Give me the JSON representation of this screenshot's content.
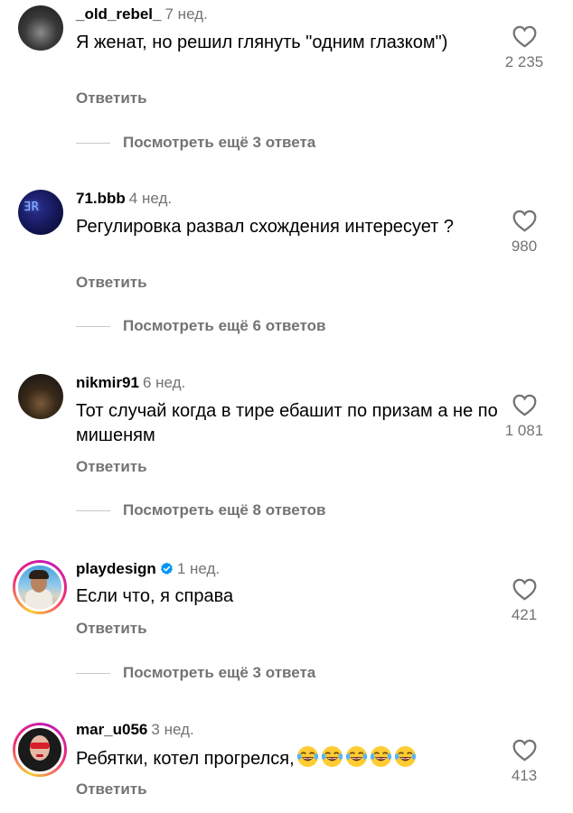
{
  "comments": [
    {
      "username": "_old_rebel_",
      "time": "7 нед.",
      "text": "Я женат, но решил глянуть \"одним глазком\")",
      "likes": "2 235",
      "reply_label": "Ответить",
      "more_replies": "Посмотреть ещё 3 ответа",
      "avatar_icon": "avatar-photo-dark"
    },
    {
      "username": "71.bbb",
      "time": "4 нед.",
      "text": "Регулировка развал схождения интересует ?",
      "likes": "980",
      "reply_label": "Ответить",
      "more_replies": "Посмотреть ещё 6 ответов",
      "avatar_icon": "avatar-neon-sign"
    },
    {
      "username": "nikmir91",
      "time": "6 нед.",
      "text": "Тот случай когда в тире ебашит по призам а не по мишеням",
      "likes": "1 081",
      "reply_label": "Ответить",
      "more_replies": "Посмотреть ещё 8 ответов",
      "avatar_icon": "avatar-photo-night"
    },
    {
      "username": "playdesign",
      "verified": true,
      "time": "1 нед.",
      "text": "Если что, я справа",
      "likes": "421",
      "reply_label": "Ответить",
      "more_replies": "Посмотреть ещё 3 ответа",
      "avatar_icon": "avatar-story-ring"
    },
    {
      "username": "mar_u056",
      "time": "3 нед.",
      "text": "Ребятки, котел прогрелся,",
      "emoji": "😂😂😂😂😂",
      "likes": "413",
      "reply_label": "Ответить",
      "avatar_icon": "avatar-story-ring"
    }
  ],
  "colors": {
    "secondary_text": "#737373",
    "verified_blue": "#0095f6",
    "divider": "#c7c7c7"
  },
  "icons": {
    "like": "heart-outline-icon",
    "verified": "verified-badge-icon",
    "emoji": "face-with-tears-of-joy"
  }
}
